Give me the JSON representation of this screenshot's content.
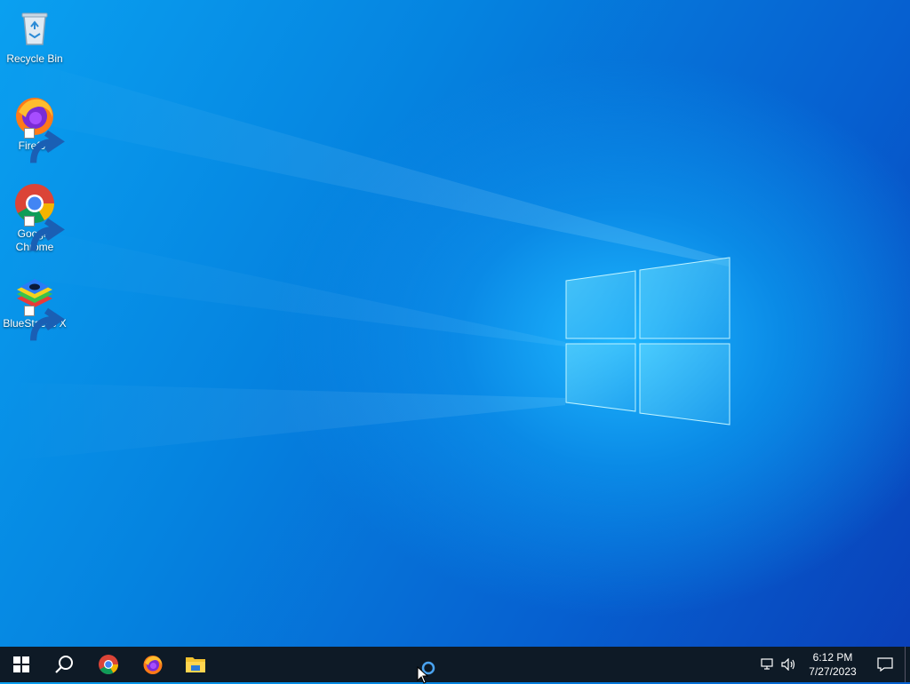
{
  "desktop": {
    "icons": [
      {
        "label": "Recycle Bin",
        "icon": "recycle-bin-icon"
      },
      {
        "label": "Firefox",
        "icon": "firefox-icon"
      },
      {
        "label": "Google Chrome",
        "icon": "chrome-icon"
      },
      {
        "label": "BlueStacks X",
        "icon": "bluestacks-icon"
      }
    ]
  },
  "taskbar": {
    "pinned": [
      {
        "icon": "windows-start-icon"
      },
      {
        "icon": "search-icon"
      },
      {
        "icon": "chrome-icon"
      },
      {
        "icon": "firefox-icon"
      },
      {
        "icon": "file-explorer-icon"
      }
    ],
    "tray": {
      "time": "6:12 PM",
      "date": "7/27/2023",
      "icons": [
        "network-icon",
        "volume-icon",
        "notification-icon"
      ]
    }
  },
  "colors": {
    "taskbar_bg": "#0e1a26",
    "wallpaper_accent": "#0a8ae6"
  }
}
